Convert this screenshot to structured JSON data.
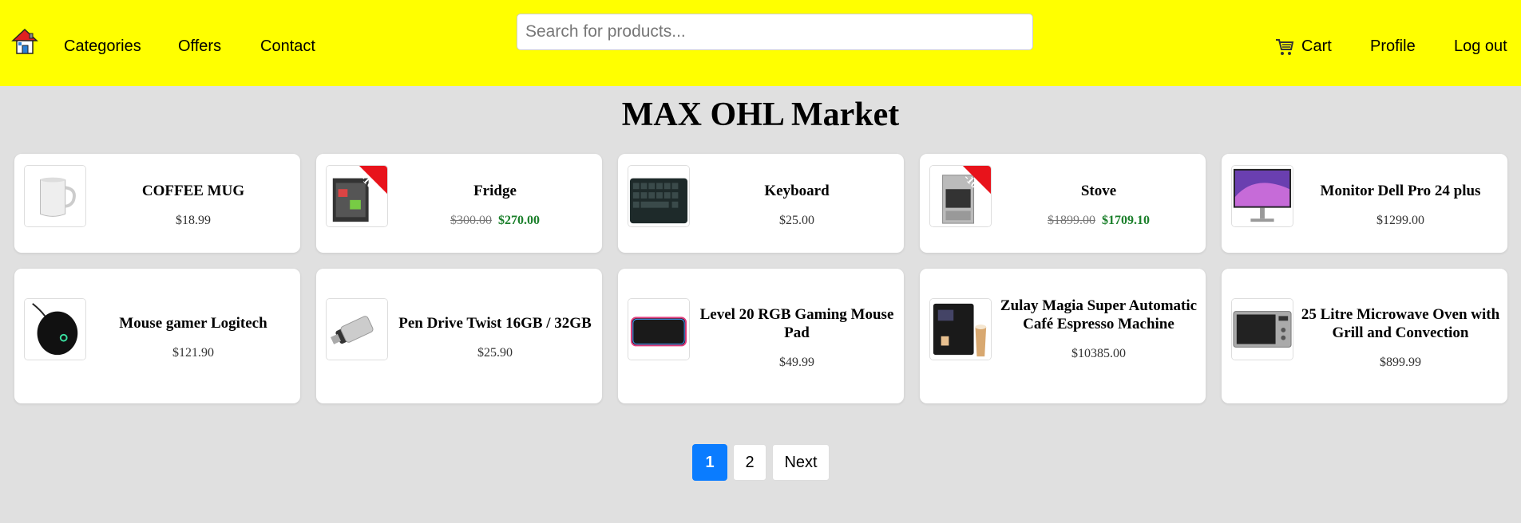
{
  "nav": {
    "categories": "Categories",
    "offers": "Offers",
    "contact": "Contact",
    "search_placeholder": "Search for products...",
    "cart": "Cart",
    "profile": "Profile",
    "logout": "Log out"
  },
  "page_title": "MAX OHL Market",
  "products": [
    {
      "name": "COFFEE MUG",
      "price": "$18.99"
    },
    {
      "name": "Fridge",
      "old_price": "$300.00",
      "price": "$270.00",
      "badge": "-10%"
    },
    {
      "name": "Keyboard",
      "price": "$25.00"
    },
    {
      "name": "Stove",
      "old_price": "$1899.00",
      "price": "$1709.10",
      "badge": "-10%"
    },
    {
      "name": "Monitor Dell Pro 24 plus",
      "price": "$1299.00"
    },
    {
      "name": "Mouse gamer Logitech",
      "price": "$121.90"
    },
    {
      "name": "Pen Drive Twist 16GB / 32GB",
      "price": "$25.90"
    },
    {
      "name": "Level 20 RGB Gaming Mouse Pad",
      "price": "$49.99"
    },
    {
      "name": "Zulay Magia Super Automatic Café Espresso Machine",
      "price": "$10385.00"
    },
    {
      "name": "25 Litre Microwave Oven with Grill and Convection",
      "price": "$899.99"
    }
  ],
  "pagination": {
    "page1": "1",
    "page2": "2",
    "next": "Next"
  },
  "colors": {
    "header_bg": "#ffff00",
    "page_bg": "#e0e0e0",
    "active_page": "#0a7cff",
    "sale_price": "#1a7f2a",
    "badge": "#e8131b"
  }
}
